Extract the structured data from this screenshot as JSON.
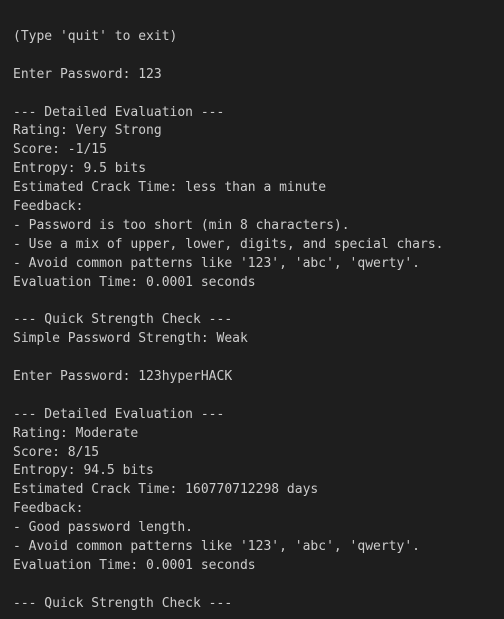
{
  "terminal": {
    "lines": [
      "(Type 'quit' to exit)",
      "",
      "Enter Password: 123",
      "",
      "--- Detailed Evaluation ---",
      "Rating: Very Strong",
      "Score: -1/15",
      "Entropy: 9.5 bits",
      "Estimated Crack Time: less than a minute",
      "Feedback:",
      "- Password is too short (min 8 characters).",
      "- Use a mix of upper, lower, digits, and special chars.",
      "- Avoid common patterns like '123', 'abc', 'qwerty'.",
      "Evaluation Time: 0.0001 seconds",
      "",
      "--- Quick Strength Check ---",
      "Simple Password Strength: Weak",
      "",
      "Enter Password: 123hyperHACK",
      "",
      "--- Detailed Evaluation ---",
      "Rating: Moderate",
      "Score: 8/15",
      "Entropy: 94.5 bits",
      "Estimated Crack Time: 160770712298 days",
      "Feedback:",
      "- Good password length.",
      "- Avoid common patterns like '123', 'abc', 'qwerty'.",
      "Evaluation Time: 0.0001 seconds",
      "",
      "--- Quick Strength Check ---"
    ]
  }
}
